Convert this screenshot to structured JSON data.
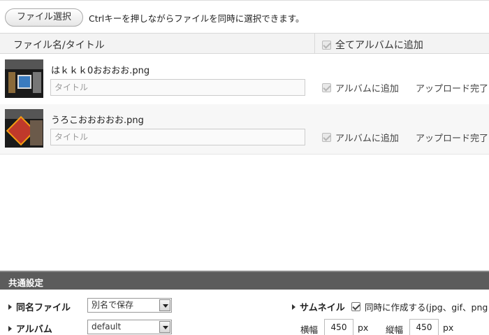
{
  "toolbar": {
    "file_select_label": "ファイル選択",
    "hint": "Ctrlキーを押しながらファイルを同時に選択できます。"
  },
  "list_header": {
    "name_col": "ファイル名/タイトル",
    "add_all_label": "全てアルバムに追加",
    "add_all_checked": true
  },
  "files": [
    {
      "name": "はｋｋｋ0おおおお.png",
      "title_placeholder": "タイトル",
      "album_label": "アルバムに追加",
      "album_checked": true,
      "status": "アップロード完了"
    },
    {
      "name": "うろこおおおおお.png",
      "title_placeholder": "タイトル",
      "album_label": "アルバムに追加",
      "album_checked": true,
      "status": "アップロード完了"
    }
  ],
  "settings": {
    "title": "共通設定",
    "same_name_label": "同名ファイル",
    "same_name_value": "別名で保存",
    "album_label": "アルバム",
    "album_value": "default",
    "thumbnail_label": "サムネイル",
    "thumbnail_option": "同時に作成する(jpg、gif、png",
    "thumbnail_checked": true,
    "width_label": "横幅",
    "width_value": "450",
    "width_unit": "px",
    "height_label": "縦幅",
    "height_value": "450",
    "height_unit": "px"
  },
  "colors": {
    "settings_bar": "#5c5c5c",
    "header_bg": "#f3f3f3"
  }
}
